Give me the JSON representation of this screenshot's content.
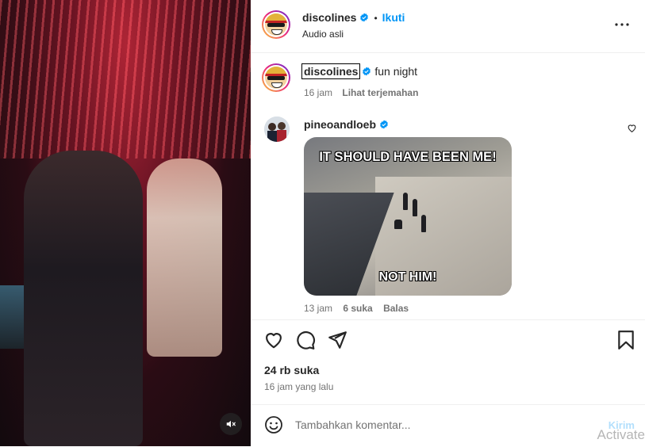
{
  "post": {
    "username": "discolines",
    "follow_label": "Ikuti",
    "audio": "Audio asli",
    "separator": "•"
  },
  "caption": {
    "username": "discolines",
    "text": "fun night",
    "time": "16 jam",
    "translate": "Lihat terjemahan"
  },
  "comments": [
    {
      "username": "pineoandloeb",
      "gif_top_text": "IT SHOULD HAVE BEEN ME!",
      "gif_bottom_text": "NOT HIM!",
      "time": "13 jam",
      "likes": "6 suka",
      "reply": "Balas"
    }
  ],
  "stats": {
    "likes": "24 rb suka",
    "posted": "16 jam yang lalu"
  },
  "composer": {
    "placeholder": "Tambahkan komentar...",
    "send_label": "Kirim"
  },
  "os_watermark": "Activate",
  "colors": {
    "accent": "#0095f6",
    "send_disabled": "#b2dffc",
    "verified": "#0095f6"
  },
  "icons": [
    "mute-icon",
    "more-icon",
    "verified-icon",
    "heart-icon",
    "comment-icon",
    "share-icon",
    "bookmark-icon",
    "emoji-icon"
  ]
}
